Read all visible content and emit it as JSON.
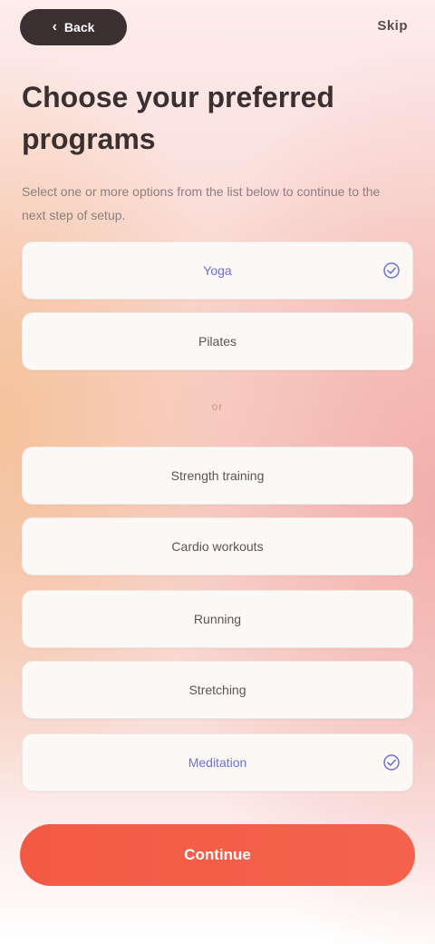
{
  "topbar": {
    "back_label": "Back",
    "skip_label": "Skip"
  },
  "heading": {
    "title": "Choose your preferred programs",
    "subtitle": "Select one or more options from the list below to continue to the next step of setup."
  },
  "options_top": [
    {
      "label": "Yoga",
      "selected": true
    },
    {
      "label": "Pilates",
      "selected": false
    }
  ],
  "divider_label": "or",
  "options_bottom": [
    {
      "label": "Strength training",
      "selected": false
    },
    {
      "label": "Cardio workouts",
      "selected": false
    },
    {
      "label": "Running",
      "selected": false
    },
    {
      "label": "Stretching",
      "selected": false
    },
    {
      "label": "Meditation",
      "selected": true
    }
  ],
  "cta": {
    "label": "Continue"
  },
  "colors": {
    "accent": "#f35a45",
    "selected_text": "#6a6fd9",
    "title": "#3a2f31"
  }
}
